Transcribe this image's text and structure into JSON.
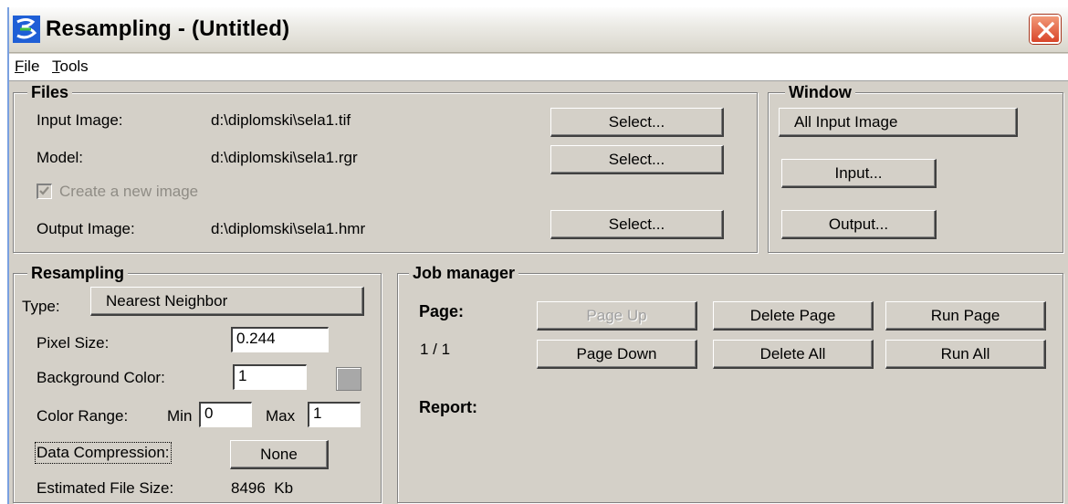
{
  "window": {
    "title": "Resampling - (Untitled)"
  },
  "menu": {
    "file": "File",
    "tools": "Tools"
  },
  "files": {
    "legend": "Files",
    "input_label": "Input Image:",
    "input_value": "d:\\diplomski\\sela1.tif",
    "input_select": "Select...",
    "model_label": "Model:",
    "model_value": "d:\\diplomski\\sela1.rgr",
    "model_select": "Select...",
    "create_new_label": "Create a new image",
    "create_new_checked": true,
    "output_label": "Output Image:",
    "output_value": "d:\\diplomski\\sela1.hmr",
    "output_select": "Select..."
  },
  "window_group": {
    "legend": "Window",
    "all_input": "All Input Image",
    "input_btn": "Input...",
    "output_btn": "Output..."
  },
  "resampling": {
    "legend": "Resampling",
    "type_label": "Type:",
    "type_value": "Nearest Neighbor",
    "pixel_size_label": "Pixel Size:",
    "pixel_size_value": "0.244",
    "bg_color_label": "Background Color:",
    "bg_color_value": "1",
    "color_range_label": "Color Range:",
    "min_label": "Min",
    "min_value": "0",
    "max_label": "Max",
    "max_value": "1",
    "compression_label": "Data Compression:",
    "compression_value": "None",
    "est_size_label": "Estimated File Size:",
    "est_size_value": "8496  Kb"
  },
  "job_manager": {
    "legend": "Job manager",
    "page_label": "Page:",
    "page_value": "1 / 1",
    "page_up": "Page Up",
    "page_down": "Page Down",
    "delete_page": "Delete Page",
    "delete_all": "Delete All",
    "run_page": "Run Page",
    "run_all": "Run All",
    "report_label": "Report:"
  },
  "colors": {
    "dialog_bg": "#d4d0c8",
    "close_red": "#d9452a"
  }
}
